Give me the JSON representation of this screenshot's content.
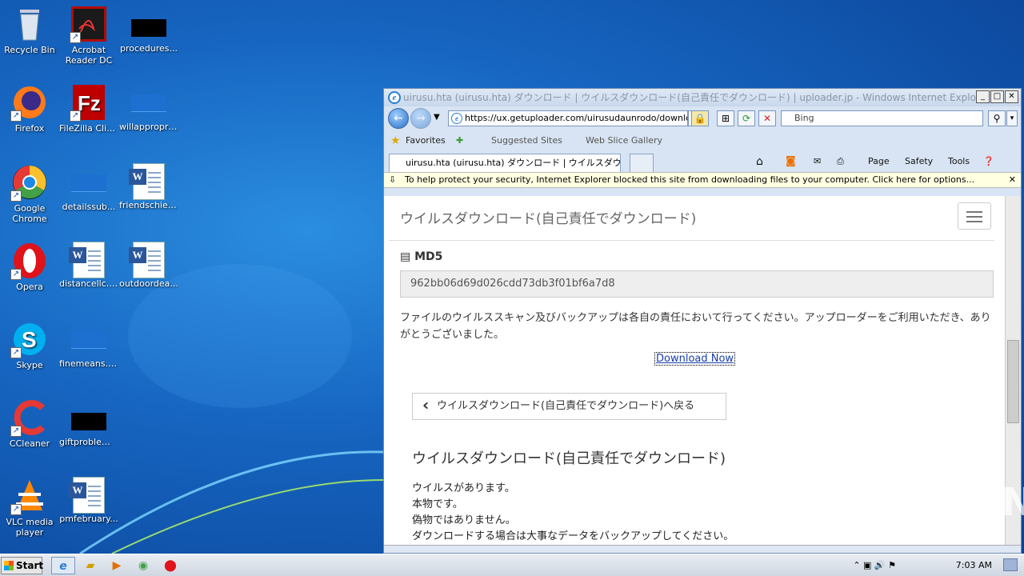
{
  "desktop": {
    "icons": [
      {
        "label": "Recycle Bin"
      },
      {
        "label": "Acrobat Reader DC"
      },
      {
        "label": "procedures..."
      },
      {
        "label": "Firefox"
      },
      {
        "label": "FileZilla Client"
      },
      {
        "label": "willappropri..."
      },
      {
        "label": "Google Chrome"
      },
      {
        "label": "detailssub..."
      },
      {
        "label": "friendschief..."
      },
      {
        "label": "Opera"
      },
      {
        "label": "distancellc.rtf"
      },
      {
        "label": "outdoordea..."
      },
      {
        "label": "Skype"
      },
      {
        "label": "finemeans.png"
      },
      {
        "label": "CCleaner"
      },
      {
        "label": "giftproblem..."
      },
      {
        "label": "VLC media player"
      },
      {
        "label": "pmfebruary..."
      }
    ]
  },
  "browser": {
    "title": "uirusu.hta (uirusu.hta) ダウンロード | ウイルスダウンロード(自己責任でダウンロード) | uploader.jp - Windows Internet Explorer",
    "address": "https://ux.getuploader.com/uirusudaunrodo/download",
    "search_placeholder": "Bing",
    "favorites": {
      "label": "Favorites",
      "suggested": "Suggested Sites",
      "webslice": "Web Slice Gallery"
    },
    "tab_label": "uirusu.hta (uirusu.hta) ダウンロード | ウイルスダウンロ...",
    "commands": {
      "page": "Page",
      "safety": "Safety",
      "tools": "Tools"
    },
    "infobar": "To help protect your security, Internet Explorer blocked this site from downloading files to your computer. Click here for options..."
  },
  "page": {
    "site_title": "ウイルスダウンロード(自己責任でダウンロード)",
    "md5_label": "MD5",
    "md5_value": "962bb06d69d026cdd73db3f01bf6a7d8",
    "notice": "ファイルのウイルススキャン及びバックアップは各自の責任において行ってください。アップローダーをご利用いただき、ありがとうございました。",
    "download_link": "Download Now",
    "back_button": "ウイルスダウンロード(自己責任でダウンロード)へ戻る",
    "section_title": "ウイルスダウンロード(自己責任でダウンロード)",
    "lines": [
      "ウイルスがあります。",
      "本物です。",
      "偽物ではありません。",
      "ダウンロードする場合は大事なデータをバックアップしてください。"
    ]
  },
  "taskbar": {
    "start": "Start",
    "clock": "7:03 AM"
  },
  "watermark": "ANY RUN"
}
